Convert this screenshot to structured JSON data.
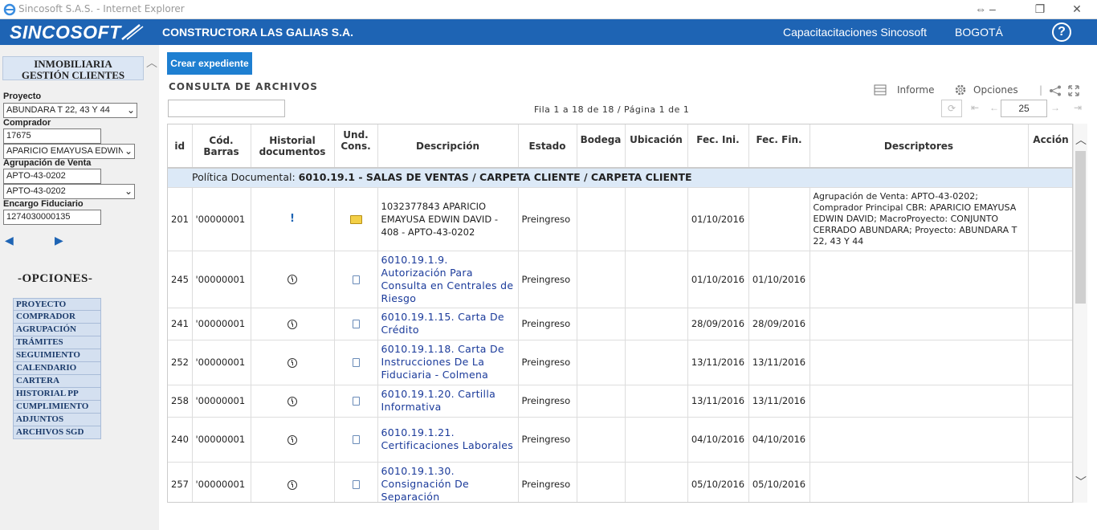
{
  "window": {
    "title": "Sincosoft S.A.S. - Internet Explorer",
    "controls": [
      "⇔ –",
      "❐",
      "✕"
    ]
  },
  "header": {
    "logo": "SINCOSOFT",
    "company": "CONSTRUCTORA LAS GALIAS S.A.",
    "user": "Capacitacitaciones Sincosoft",
    "city": "BOGOTÁ",
    "help": "?"
  },
  "sidebar": {
    "heading_line1": "INMOBILIARIA",
    "heading_line2": "GESTIÓN CLIENTES",
    "proyecto_label": "Proyecto",
    "proyecto_value": "ABUNDARA T 22, 43 Y 44",
    "comprador_label": "Comprador",
    "comprador_id": "17675",
    "comprador_value": "APARICIO EMAYUSA EDWIN",
    "agrupacion_label": "Agrupación de Venta",
    "agrupacion_input": "APTO-43-0202",
    "agrupacion_value": "APTO-43-0202",
    "encargo_label": "Encargo Fiduciario",
    "encargo_value": "1274030000135",
    "opciones_title": "-OPCIONES-",
    "menu": [
      "Proyecto",
      "Comprador",
      "Agrupación",
      "Trámites",
      "Seguimiento",
      "Calendario",
      "Cartera",
      "Historial PP",
      "Cumplimiento",
      "Adjuntos",
      "Archivos SGD"
    ]
  },
  "main": {
    "create_button": "Crear expediente",
    "section_title": "CONSULTA DE ARCHIVOS",
    "informe_label": "Informe",
    "opciones_label": "Opciones",
    "page_info": "Fila 1 a 18 de 18 / Página 1 de 1",
    "page_size": "25"
  },
  "table": {
    "headers": {
      "id": "id",
      "barras1": "Cód.",
      "barras2": "Barras",
      "hist1": "Historial",
      "hist2": "documentos",
      "und1": "Und.",
      "und2": "Cons.",
      "descripcion": "Descripción",
      "estado": "Estado",
      "bodega": "Bodega",
      "ubicacion": "Ubicación",
      "fecini": "Fec. Ini.",
      "fecfin": "Fec. Fin.",
      "descriptores": "Descriptores",
      "accion": "Acción"
    },
    "group_prefix": "Política Documental: ",
    "group_value": "6010.19.1 - SALAS DE VENTAS / CARPETA CLIENTE / CARPETA CLIENTE",
    "rows": [
      {
        "id": "201",
        "barras": "'00000001",
        "hist": "!",
        "desc": "1032377843 APARICIO EMAYUSA EDWIN DAVID - 408 - APTO-43-0202",
        "estado": "Preingreso",
        "ini": "01/10/2016",
        "fin": "",
        "descriptores": "Agrupación de Venta: APTO-43-0202; Comprador Principal CBR: APARICIO EMAYUSA EDWIN DAVID; MacroProyecto: CONJUNTO CERRADO ABUNDARA; Proyecto: ABUNDARA T 22, 43 Y 44"
      },
      {
        "id": "245",
        "barras": "'00000001",
        "desc": "6010.19.1.9. Autorización Para Consulta en Centrales de Riesgo",
        "estado": "Preingreso",
        "ini": "01/10/2016",
        "fin": "01/10/2016"
      },
      {
        "id": "241",
        "barras": "'00000001",
        "desc": "6010.19.1.15. Carta De Crédito",
        "estado": "Preingreso",
        "ini": "28/09/2016",
        "fin": "28/09/2016"
      },
      {
        "id": "252",
        "barras": "'00000001",
        "desc": "6010.19.1.18. Carta De Instrucciones De La Fiduciaria - Colmena",
        "estado": "Preingreso",
        "ini": "13/11/2016",
        "fin": "13/11/2016"
      },
      {
        "id": "258",
        "barras": "'00000001",
        "desc": "6010.19.1.20. Cartilla Informativa",
        "estado": "Preingreso",
        "ini": "13/11/2016",
        "fin": "13/11/2016"
      },
      {
        "id": "240",
        "barras": "'00000001",
        "desc": "6010.19.1.21. Certificaciones Laborales",
        "estado": "Preingreso",
        "ini": "04/10/2016",
        "fin": "04/10/2016"
      },
      {
        "id": "257",
        "barras": "'00000001",
        "desc": "6010.19.1.30. Consignación De Separación",
        "estado": "Preingreso",
        "ini": "05/10/2016",
        "fin": "05/10/2016"
      }
    ]
  },
  "colors": {
    "brand": "#1e64b4",
    "button": "#1e7fd1",
    "group_row": "#dce9f7"
  }
}
